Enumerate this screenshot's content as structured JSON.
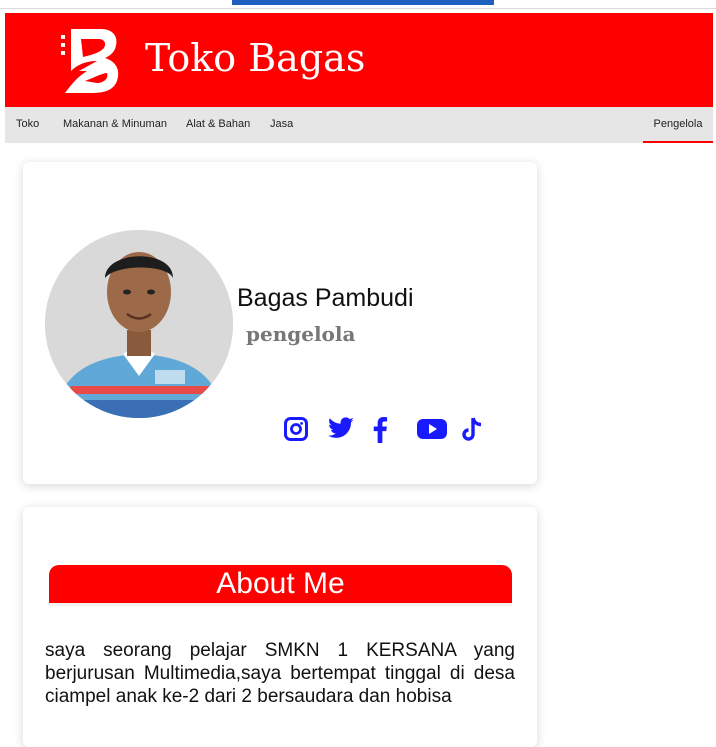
{
  "app": {
    "title": "Toko Bagas"
  },
  "nav": {
    "items": [
      {
        "label": "Toko"
      },
      {
        "label": "Makanan & Minuman"
      },
      {
        "label": "Alat & Bahan"
      },
      {
        "label": "Jasa"
      }
    ],
    "right_label": "Pengelola",
    "active": "Pengelola"
  },
  "profile": {
    "name": "Bagas Pambudi",
    "role": "pengelola",
    "social": [
      "instagram-icon",
      "twitter-icon",
      "facebook-icon",
      "youtube-icon",
      "tiktok-icon"
    ]
  },
  "about": {
    "title": "About Me",
    "text": "saya seorang pelajar SMKN 1 KERSANA yang berjurusan Multimedia,saya bertempat tinggal di desa ciampel anak ke-2 dari 2 bersaudara dan hobisa"
  },
  "colors": {
    "brand": "#ff0000",
    "accent": "#1a1aff",
    "nav_bg": "#e6e6e6"
  }
}
